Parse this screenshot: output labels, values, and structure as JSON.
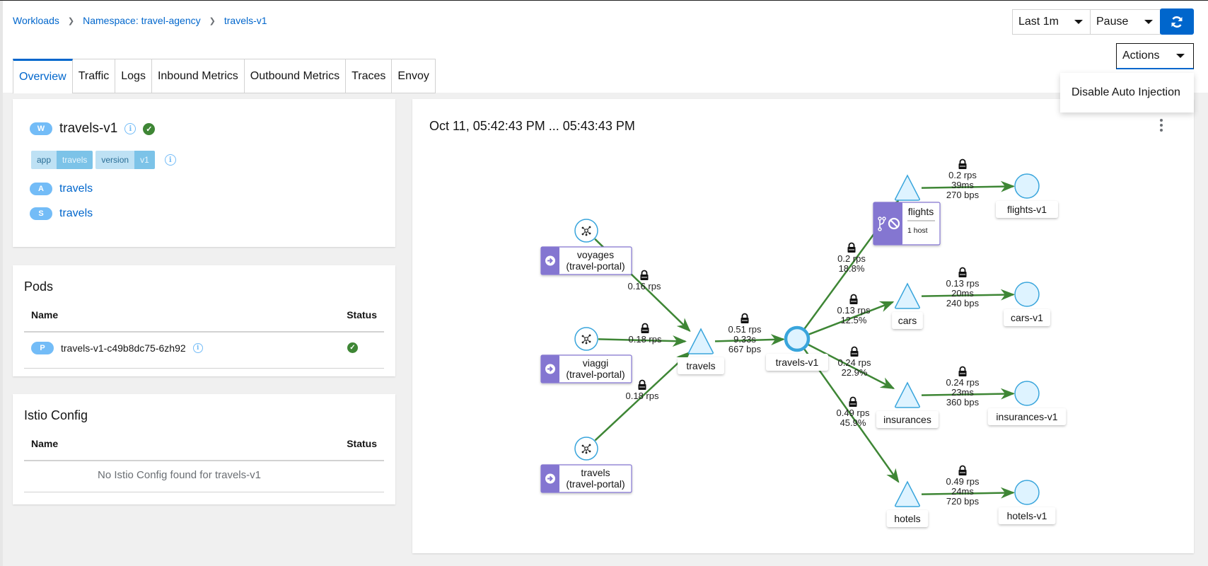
{
  "breadcrumb": [
    {
      "label": "Workloads"
    },
    {
      "label": "Namespace: travel-agency"
    },
    {
      "label": "travels-v1"
    }
  ],
  "tabs": [
    {
      "label": "Overview",
      "active": true
    },
    {
      "label": "Traffic"
    },
    {
      "label": "Logs"
    },
    {
      "label": "Inbound Metrics"
    },
    {
      "label": "Outbound Metrics"
    },
    {
      "label": "Traces"
    },
    {
      "label": "Envoy"
    }
  ],
  "toolbar": {
    "duration": "Last 1m",
    "refresh_interval": "Pause",
    "refresh_icon": "sync-icon",
    "actions_label": "Actions",
    "actions_menu": [
      "Disable Auto Injection"
    ]
  },
  "workload": {
    "badge": "W",
    "name": "travels-v1",
    "health": "healthy",
    "labels": [
      {
        "key": "app",
        "value": "travels"
      },
      {
        "key": "version",
        "value": "v1"
      }
    ],
    "app": {
      "badge": "A",
      "name": "travels"
    },
    "service": {
      "badge": "S",
      "name": "travels"
    }
  },
  "pods": {
    "title": "Pods",
    "columns": [
      "Name",
      "Status"
    ],
    "rows": [
      {
        "badge": "P",
        "name": "travels-v1-c49b8dc75-6zh92",
        "status": "healthy"
      }
    ]
  },
  "istio_config": {
    "title": "Istio Config",
    "columns": [
      "Name",
      "Status"
    ],
    "empty_message": "No Istio Config found for travels-v1"
  },
  "graph": {
    "time_range": "Oct 11, 05:42:43 PM ... 05:43:43 PM",
    "colors": {
      "edge": "#3e8635",
      "node_fill": "#def3ff",
      "node_stroke": "#39a5dc",
      "app_box": "#8476d1"
    },
    "nodes": [
      {
        "id": "voyages-src",
        "type": "unknown-root",
        "label": "voyages\n(travel-portal)"
      },
      {
        "id": "viaggi-src",
        "type": "unknown-root",
        "label": "viaggi\n(travel-portal)"
      },
      {
        "id": "travels-src",
        "type": "unknown-root",
        "label": "travels\n(travel-portal)"
      },
      {
        "id": "travels-svc",
        "type": "service",
        "label": "travels"
      },
      {
        "id": "travels-v1",
        "type": "workload",
        "label": "travels-v1",
        "focused": true
      },
      {
        "id": "flights-svc",
        "type": "service",
        "label": "flights",
        "sub": "1 host"
      },
      {
        "id": "cars-svc",
        "type": "service",
        "label": "cars"
      },
      {
        "id": "insurances-svc",
        "type": "service",
        "label": "insurances"
      },
      {
        "id": "hotels-svc",
        "type": "service",
        "label": "hotels"
      },
      {
        "id": "flights-v1",
        "type": "workload",
        "label": "flights-v1"
      },
      {
        "id": "cars-v1",
        "type": "workload",
        "label": "cars-v1"
      },
      {
        "id": "insurances-v1",
        "type": "workload",
        "label": "insurances-v1"
      },
      {
        "id": "hotels-v1",
        "type": "workload",
        "label": "hotels-v1"
      }
    ],
    "edges": [
      {
        "from": "voyages-src",
        "to": "travels-svc",
        "label": [
          "0.16 rps"
        ],
        "mtls": true
      },
      {
        "from": "viaggi-src",
        "to": "travels-svc",
        "label": [
          "0.18 rps"
        ],
        "mtls": true
      },
      {
        "from": "travels-src",
        "to": "travels-svc",
        "label": [
          "0.18 rps"
        ],
        "mtls": true
      },
      {
        "from": "travels-svc",
        "to": "travels-v1",
        "label": [
          "0.51 rps",
          "9.33s",
          "667 bps"
        ],
        "mtls": true
      },
      {
        "from": "travels-v1",
        "to": "flights-svc",
        "label": [
          "0.2 rps",
          "18.8%"
        ],
        "mtls": true
      },
      {
        "from": "travels-v1",
        "to": "cars-svc",
        "label": [
          "0.13 rps",
          "12.5%"
        ],
        "mtls": true
      },
      {
        "from": "travels-v1",
        "to": "insurances-svc",
        "label": [
          "0.24 rps",
          "22.9%"
        ],
        "mtls": true
      },
      {
        "from": "travels-v1",
        "to": "hotels-svc",
        "label": [
          "0.49 rps",
          "45.9%"
        ],
        "mtls": true
      },
      {
        "from": "flights-svc",
        "to": "flights-v1",
        "label": [
          "0.2 rps",
          "39ms",
          "270 bps"
        ],
        "mtls": true
      },
      {
        "from": "cars-svc",
        "to": "cars-v1",
        "label": [
          "0.13 rps",
          "20ms",
          "240 bps"
        ],
        "mtls": true
      },
      {
        "from": "insurances-svc",
        "to": "insurances-v1",
        "label": [
          "0.24 rps",
          "23ms",
          "360 bps"
        ],
        "mtls": true
      },
      {
        "from": "hotels-svc",
        "to": "hotels-v1",
        "label": [
          "0.49 rps",
          "24ms",
          "720 bps"
        ],
        "mtls": true
      }
    ]
  }
}
